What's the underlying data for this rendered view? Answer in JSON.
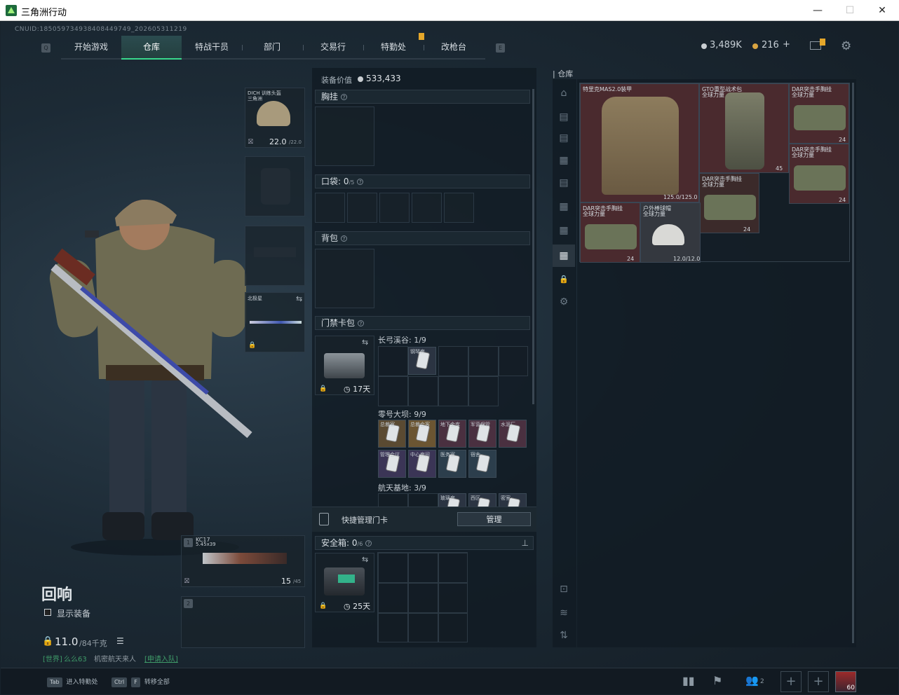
{
  "window": {
    "title": "三角洲行动",
    "minimize": "—",
    "maximize": "☐",
    "close": "✕"
  },
  "cnuid": "CNUID:18505973493840844974​9_202605311219",
  "nav": {
    "tabs": [
      "开始游戏",
      "仓库",
      "特战干员",
      "部门",
      "交易行",
      "特勤处",
      "改枪台"
    ],
    "active": "仓库"
  },
  "currency": {
    "silver": "3,489K",
    "gold": "216",
    "plus": "+"
  },
  "character": {
    "operator": "回响",
    "show_gear": "显示装备",
    "weight": "11.0",
    "weight_max": "/84千克",
    "chat_channel": "[世界]",
    "chat_user": "么么63",
    "chat_msg": "机密航天来人",
    "chat_link": "[申请入队]"
  },
  "equipment": {
    "helmet_name": "DICH 训练头盔",
    "helmet_sub": "三角洲",
    "helmet_dur": "22.0",
    "helmet_dur_max": "/22.0",
    "melee_name": "北极星",
    "gun1_slot": "1",
    "gun1_name": "KC17",
    "gun1_ammo_type": "5.45x39",
    "gun1_ammo": "15",
    "gun1_ammo_max": "/45",
    "gun2_slot": "2"
  },
  "loadout": {
    "value_label": "装备价值",
    "value": "533,433",
    "chest_rig": "胸挂",
    "pockets": "口袋: ",
    "pockets_count": "0",
    "pockets_max": "/5",
    "backpack": "背包",
    "keycard_bag": "门禁卡包",
    "keycard_days": "17天",
    "zone1": "长弓溪谷: 1/9",
    "zone1_card": "钢琴房",
    "zone2": "零号大坝: 9/9",
    "zone2_cards": [
      "总裁室",
      "总裁会客",
      "地下金库",
      "军营保管",
      "水泥厂",
      "管理会议",
      "中心房间",
      "医务室",
      "宿舍"
    ],
    "zone3": "航天基地: 3/9",
    "zone3_cards": [
      "玻璃房",
      "西区",
      "密室"
    ],
    "quick_manage": "快捷管理门卡",
    "manage_btn": "管理",
    "safe_box": "安全箱: ",
    "safe_count": "0",
    "safe_max": "/6",
    "safe_days": "25天"
  },
  "storage": {
    "title": "仓库",
    "items": [
      {
        "name": "特里克MAS2.0装甲",
        "value": "125.0/125.0"
      },
      {
        "name": "GTO重型战术包",
        "sub": "全球力量",
        "value": "45"
      },
      {
        "name": "DAR突击手胸挂",
        "sub": "全球力量",
        "value": "24"
      },
      {
        "name": "DAR突击手胸挂",
        "sub": "全球力量",
        "value": "24"
      },
      {
        "name": "DAR突击手胸挂",
        "sub": "全球力量",
        "value": "24"
      },
      {
        "name": "DAR突击手胸挂",
        "sub": "全球力量",
        "value": "24"
      },
      {
        "name": "户外棒球帽",
        "sub": "全球力量",
        "value": "12.0/12.0"
      }
    ]
  },
  "bottom": {
    "tab_key": "Tab",
    "tab_label": "进入特勤处",
    "ctrl_key": "Ctrl",
    "f_key": "F",
    "ctrl_label": "转移全部",
    "squad_count": "2",
    "avatar_level": "60"
  },
  "colors": {
    "accent": "#39d88c",
    "badge": "#e5a72a",
    "bg": "#18232c"
  }
}
